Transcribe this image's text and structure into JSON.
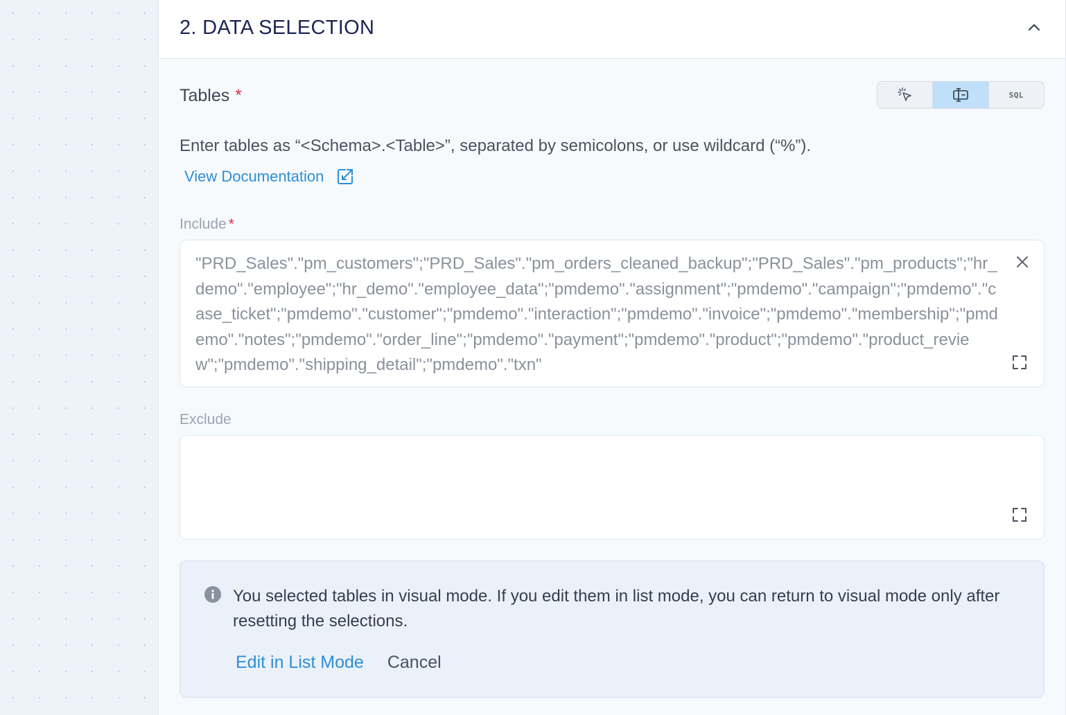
{
  "section": {
    "title": "2. DATA SELECTION"
  },
  "tables": {
    "label": "Tables",
    "required_mark": "*",
    "mode_toggle": {
      "options": [
        "visual-mode",
        "list-mode",
        "SQL"
      ],
      "selected": "list-mode",
      "sql_label": "SQL"
    },
    "help_text": "Enter tables as “<Schema>.<Table>”, separated by semicolons, or use wildcard (“%”).",
    "doc_link": "View Documentation"
  },
  "include": {
    "label": "Include",
    "required_mark": "*",
    "value": "\"PRD_Sales\".\"pm_customers\";\"PRD_Sales\".\"pm_orders_cleaned_backup\";\"PRD_Sales\".\"pm_products\";\"hr_demo\".\"employee\";\"hr_demo\".\"employee_data\";\"pmdemo\".\"assignment\";\"pmdemo\".\"campaign\";\"pmdemo\".\"case_ticket\";\"pmdemo\".\"customer\";\"pmdemo\".\"interaction\";\"pmdemo\".\"invoice\";\"pmdemo\".\"membership\";\"pmdemo\".\"notes\";\"pmdemo\".\"order_line\";\"pmdemo\".\"payment\";\"pmdemo\".\"product\";\"pmdemo\".\"product_review\";\"pmdemo\".\"shipping_detail\";\"pmdemo\".\"txn\""
  },
  "exclude": {
    "label": "Exclude",
    "value": ""
  },
  "notice": {
    "message": "You selected tables in visual mode. If you edit them in list mode, you can return to visual mode only after resetting the selections.",
    "primary_action": "Edit in List Mode",
    "secondary_action": "Cancel"
  },
  "colors": {
    "accent": "#2d8fd6",
    "required": "#d0344b",
    "title": "#1c2453",
    "active_toggle": "#bfe0f8"
  }
}
